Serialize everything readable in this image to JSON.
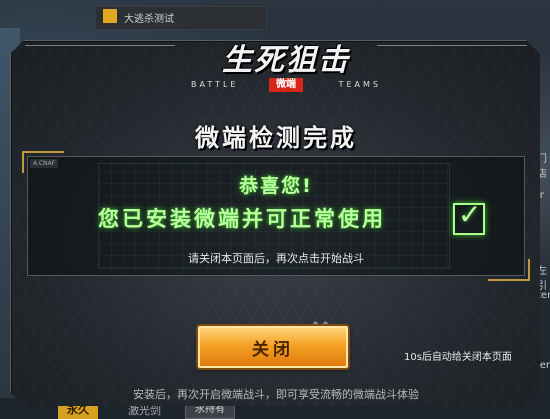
{
  "background": {
    "top_text": "大逃杀测试",
    "right_texts": [
      "门店",
      "ir",
      "左引",
      "ter",
      "ler"
    ],
    "bottom_left_label": "永久",
    "bottom_text": "激光剑",
    "bottom_badge": "永持有"
  },
  "logo": {
    "title": "生死狙击",
    "sub_left": "BATTLE",
    "sub_right": "TEAMS",
    "badge": "微端"
  },
  "dialog": {
    "headline": "微端检测完成",
    "panel_tag": "A.CNAF",
    "congrats": "恭喜您!",
    "installed_msg": "您已安装微端并可正常使用",
    "check_icon": "checkmark-icon",
    "instruction": "请关闭本页面后，再次点击开始战斗",
    "close_label": "关闭",
    "auto_close_text": "10s后自动给关闭本页面",
    "footer_tip": "安装后，再次开启微端战斗，即可享受流畅的微端战斗体验"
  },
  "colors": {
    "accent_green": "#b9ff9e",
    "button_orange": "#f5a224",
    "panel_gold": "#c29a3e",
    "badge_red": "#d8261b"
  }
}
